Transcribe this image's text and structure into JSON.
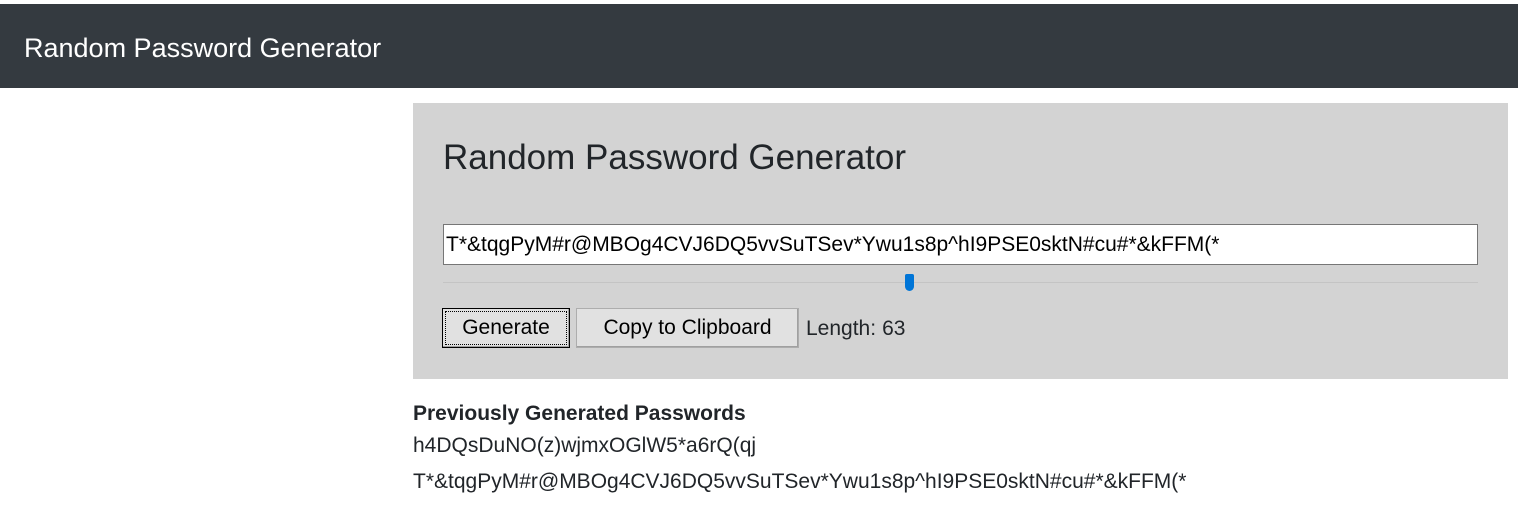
{
  "navbar": {
    "brand": "Random Password Generator"
  },
  "generator": {
    "title": "Random Password Generator",
    "password": "T*&tqgPyM#r@MBOg4CVJ6DQ5vvSuTSev*Ywu1s8p^hI9PSE0sktN#cu#*&kFFM(*",
    "slider_fraction": 0.45,
    "accent_color": "#0075d7",
    "generate_label": "Generate",
    "copy_label": "Copy to Clipboard",
    "length_label": "Length:",
    "length_value": "63"
  },
  "history": {
    "title": "Previously Generated Passwords",
    "items": [
      "h4DQsDuNO(z)wjmxOGlW5*a6rQ(qj",
      "T*&tqgPyM#r@MBOg4CVJ6DQ5vvSuTSev*Ywu1s8p^hI9PSE0sktN#cu#*&kFFM(*"
    ]
  }
}
